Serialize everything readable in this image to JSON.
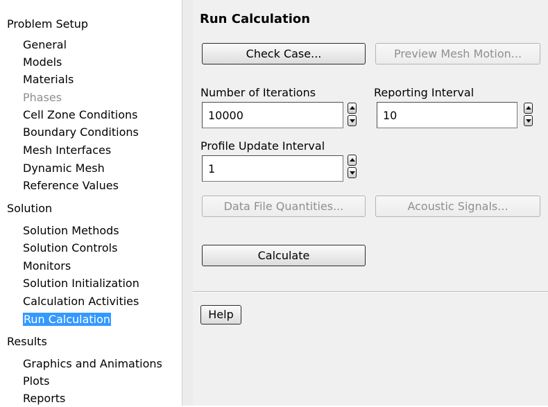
{
  "tree": {
    "problem_setup": {
      "label": "Problem Setup",
      "items": [
        {
          "label": "General"
        },
        {
          "label": "Models"
        },
        {
          "label": "Materials"
        },
        {
          "label": "Phases"
        },
        {
          "label": "Cell Zone Conditions"
        },
        {
          "label": "Boundary Conditions"
        },
        {
          "label": "Mesh Interfaces"
        },
        {
          "label": "Dynamic Mesh"
        },
        {
          "label": "Reference Values"
        }
      ]
    },
    "solution": {
      "label": "Solution",
      "items": [
        {
          "label": "Solution Methods"
        },
        {
          "label": "Solution Controls"
        },
        {
          "label": "Monitors"
        },
        {
          "label": "Solution Initialization"
        },
        {
          "label": "Calculation Activities"
        },
        {
          "label": "Run Calculation",
          "selected": true
        }
      ]
    },
    "results": {
      "label": "Results",
      "items": [
        {
          "label": "Graphics and Animations"
        },
        {
          "label": "Plots"
        },
        {
          "label": "Reports"
        }
      ]
    }
  },
  "panel": {
    "title": "Run Calculation",
    "check_case_label": "Check Case...",
    "preview_mesh_motion_label": "Preview Mesh Motion...",
    "iterations": {
      "label": "Number of Iterations",
      "value": "10000"
    },
    "reporting_interval": {
      "label": "Reporting Interval",
      "value": "10"
    },
    "profile_update_interval": {
      "label": "Profile Update Interval",
      "value": "1"
    },
    "data_file_quantities_label": "Data File Quantities...",
    "acoustic_signals_label": "Acoustic Signals...",
    "calculate_label": "Calculate",
    "help_label": "Help"
  },
  "colors": {
    "selection": "#3399ff",
    "panel_background": "#f0f0f0",
    "disabled_text": "#8e8e8e"
  }
}
